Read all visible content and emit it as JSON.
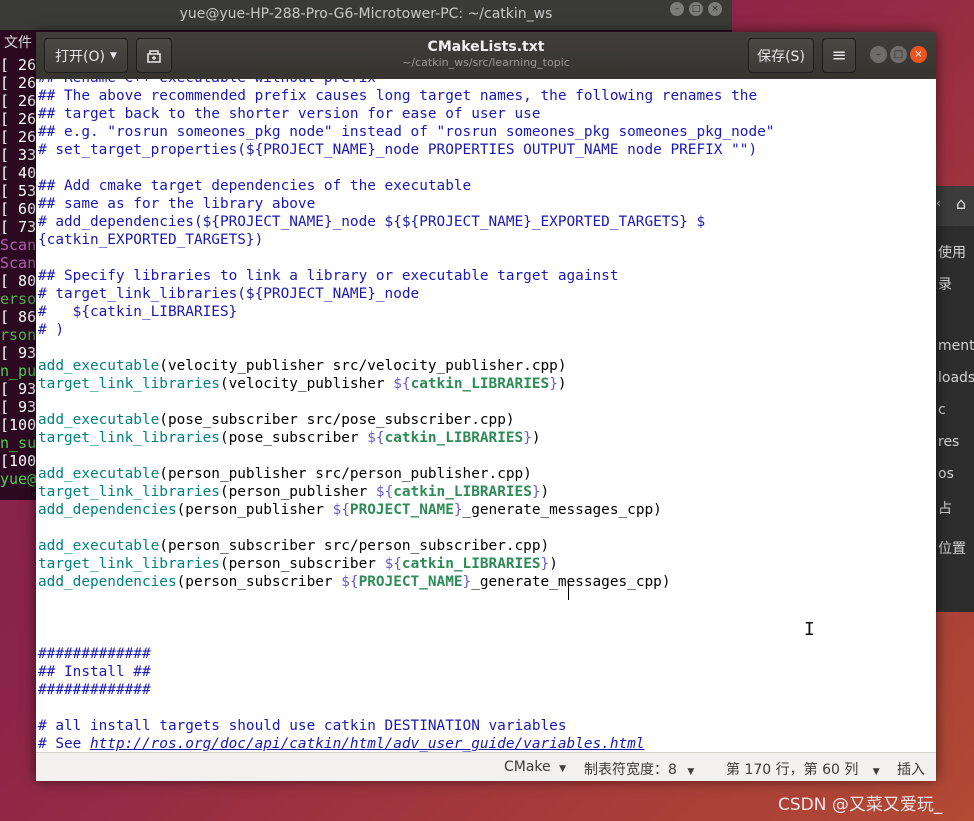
{
  "terminal": {
    "title": "yue@yue-HP-288-Pro-G6-Microtower-PC: ~/catkin_ws",
    "menu_label": "文件",
    "lines": [
      {
        "text": "[ 26",
        "color": "#ffffff"
      },
      {
        "text": "[ 26",
        "color": "#ffffff"
      },
      {
        "text": "[ 26",
        "color": "#ffffff"
      },
      {
        "text": "[ 26",
        "color": "#ffffff"
      },
      {
        "text": "[ 26",
        "color": "#ffffff"
      },
      {
        "text": "[ 33",
        "color": "#ffffff"
      },
      {
        "text": "[ 40",
        "color": "#ffffff"
      },
      {
        "text": "[ 53",
        "color": "#ffffff"
      },
      {
        "text": "[ 60",
        "color": "#ffffff"
      },
      {
        "text": "[ 73",
        "color": "#ffffff"
      },
      {
        "text": "Scan",
        "color": "#b05fb0"
      },
      {
        "text": "Scan",
        "color": "#b05fb0"
      },
      {
        "text": "[ 80",
        "color": "#ffffff"
      },
      {
        "text": "erso",
        "color": "#4fb34f"
      },
      {
        "text": "[ 86",
        "color": "#ffffff"
      },
      {
        "text": "rson",
        "color": "#4fb34f"
      },
      {
        "text": "[ 93",
        "color": "#ffffff"
      },
      {
        "text": "n_pu",
        "color": "#4fd04f"
      },
      {
        "text": "[ 93",
        "color": "#ffffff"
      },
      {
        "text": "[ 93",
        "color": "#ffffff"
      },
      {
        "text": "[100",
        "color": "#ffffff"
      },
      {
        "text": "n_su",
        "color": "#4fd04f"
      },
      {
        "text": "[100",
        "color": "#ffffff"
      },
      {
        "text": "yue@",
        "color": "#4fd04f"
      }
    ]
  },
  "file_manager": {
    "items": [
      "使用",
      "录",
      "ments",
      "loads",
      "c",
      "res",
      "os",
      "占",
      "位置"
    ]
  },
  "gedit": {
    "open_label": "打开(O)",
    "title": "CMakeLists.txt",
    "path": "~/catkin_ws/src/learning_topic",
    "save_label": "保存(S)",
    "menu_icon": "≡",
    "code_lines": [
      [
        {
          "t": "## Rename C++ executable without prefix",
          "c": "c"
        }
      ],
      [
        {
          "t": "## The above recommended prefix causes long target names, the following renames the",
          "c": "c"
        }
      ],
      [
        {
          "t": "## target back to the shorter version for ease of user use",
          "c": "c"
        }
      ],
      [
        {
          "t": "## e.g. \"rosrun someones_pkg node\" instead of \"rosrun someones_pkg someones_pkg_node\"",
          "c": "c"
        }
      ],
      [
        {
          "t": "# set_target_properties(${PROJECT_NAME}_node PROPERTIES OUTPUT_NAME node PREFIX \"\")",
          "c": "c"
        }
      ],
      [],
      [
        {
          "t": "## Add cmake target dependencies of the executable",
          "c": "c"
        }
      ],
      [
        {
          "t": "## same as for the library above",
          "c": "c"
        }
      ],
      [
        {
          "t": "# add_dependencies(${PROJECT_NAME}_node ${${PROJECT_NAME}_EXPORTED_TARGETS} $",
          "c": "c"
        }
      ],
      [
        {
          "t": "{catkin_EXPORTED_TARGETS})",
          "c": "c"
        }
      ],
      [],
      [
        {
          "t": "## Specify libraries to link a library or executable target against",
          "c": "c"
        }
      ],
      [
        {
          "t": "# target_link_libraries(${PROJECT_NAME}_node",
          "c": "c"
        }
      ],
      [
        {
          "t": "#   ${catkin_LIBRARIES}",
          "c": "c"
        }
      ],
      [
        {
          "t": "# )",
          "c": "c"
        }
      ],
      [],
      [
        {
          "t": "add_executable",
          "c": "fn"
        },
        {
          "t": "(velocity_publisher src/velocity_publisher.cpp)",
          "c": ""
        }
      ],
      [
        {
          "t": "target_link_libraries",
          "c": "fn"
        },
        {
          "t": "(velocity_publisher ",
          "c": ""
        },
        {
          "t": "${",
          "c": "vr"
        },
        {
          "t": "catkin_LIBRARIES",
          "c": "kw"
        },
        {
          "t": "}",
          "c": "vr"
        },
        {
          "t": ")",
          "c": ""
        }
      ],
      [],
      [
        {
          "t": "add_executable",
          "c": "fn"
        },
        {
          "t": "(pose_subscriber src/pose_subscriber.cpp)",
          "c": ""
        }
      ],
      [
        {
          "t": "target_link_libraries",
          "c": "fn"
        },
        {
          "t": "(pose_subscriber ",
          "c": ""
        },
        {
          "t": "${",
          "c": "vr"
        },
        {
          "t": "catkin_LIBRARIES",
          "c": "kw"
        },
        {
          "t": "}",
          "c": "vr"
        },
        {
          "t": ")",
          "c": ""
        }
      ],
      [],
      [
        {
          "t": "add_executable",
          "c": "fn"
        },
        {
          "t": "(person_publisher src/person_publisher.cpp)",
          "c": ""
        }
      ],
      [
        {
          "t": "target_link_libraries",
          "c": "fn"
        },
        {
          "t": "(person_publisher ",
          "c": ""
        },
        {
          "t": "${",
          "c": "vr"
        },
        {
          "t": "catkin_LIBRARIES",
          "c": "kw"
        },
        {
          "t": "}",
          "c": "vr"
        },
        {
          "t": ")",
          "c": ""
        }
      ],
      [
        {
          "t": "add_dependencies",
          "c": "fn"
        },
        {
          "t": "(person_publisher ",
          "c": ""
        },
        {
          "t": "${",
          "c": "vr"
        },
        {
          "t": "PROJECT_NAME",
          "c": "kw"
        },
        {
          "t": "}",
          "c": "vr"
        },
        {
          "t": "_generate_messages_cpp)",
          "c": ""
        }
      ],
      [],
      [
        {
          "t": "add_executable",
          "c": "fn"
        },
        {
          "t": "(person_subscriber src/person_subscriber.cpp)",
          "c": ""
        }
      ],
      [
        {
          "t": "target_link_libraries",
          "c": "fn"
        },
        {
          "t": "(person_subscriber ",
          "c": ""
        },
        {
          "t": "${",
          "c": "vr"
        },
        {
          "t": "catkin_LIBRARIES",
          "c": "kw"
        },
        {
          "t": "}",
          "c": "vr"
        },
        {
          "t": ")",
          "c": ""
        }
      ],
      [
        {
          "t": "add_dependencies",
          "c": "fn"
        },
        {
          "t": "(person_subscriber ",
          "c": ""
        },
        {
          "t": "${",
          "c": "vr"
        },
        {
          "t": "PROJECT_NAME",
          "c": "kw"
        },
        {
          "t": "}",
          "c": "vr"
        },
        {
          "t": "_generate_messages_cpp)",
          "c": ""
        }
      ],
      [],
      [],
      [],
      [
        {
          "t": "#############",
          "c": "c"
        }
      ],
      [
        {
          "t": "## Install ##",
          "c": "c"
        }
      ],
      [
        {
          "t": "#############",
          "c": "c"
        }
      ],
      [],
      [
        {
          "t": "# all install targets should use catkin DESTINATION variables",
          "c": "c"
        }
      ],
      [
        {
          "t": "# See ",
          "c": "c"
        },
        {
          "t": "http://ros.org/doc/api/catkin/html/adv_user_guide/variables.html",
          "c": "ln"
        }
      ]
    ],
    "status": {
      "language": "CMake",
      "tab_width": "制表符宽度：8",
      "position": "第 170 行，第 60 列",
      "mode": "插入"
    }
  },
  "watermark": "CSDN @又菜又爱玩_"
}
